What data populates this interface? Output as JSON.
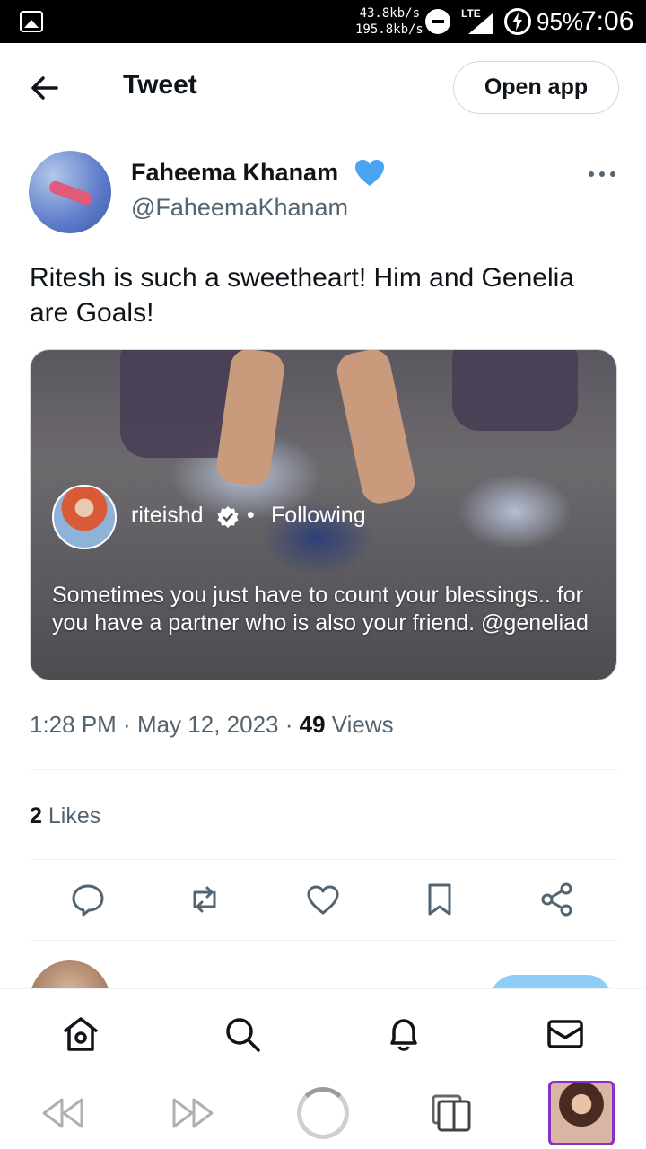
{
  "status_bar": {
    "speed_up": "43.8kb/s",
    "speed_down": "195.8kb/s",
    "network": "LTE",
    "battery": "95%",
    "time": "7:06"
  },
  "header": {
    "title": "Tweet",
    "open_app_label": "Open app",
    "back_icon": "arrow-left-icon"
  },
  "tweet": {
    "author_name": "Faheema Khanam",
    "handle": "@FaheemaKhanam",
    "text": "Ritesh is such a sweetheart!  Him and Genelia are Goals!",
    "media": {
      "username": "riteishd",
      "separator": "•",
      "following_label": "Following",
      "caption": "Sometimes you just have to count your blessings.. for you have a partner who is also your friend. @geneliad"
    },
    "time": "1:28 PM",
    "date": "May 12, 2023",
    "views_count": "49",
    "views_label": "Views",
    "likes_count": "2",
    "likes_label": "Likes"
  },
  "colors": {
    "verified": "#4ba3f4",
    "accent": "#1d9bf0",
    "muted_text": "#536471",
    "browser_tab_border": "#8b2fc9"
  }
}
